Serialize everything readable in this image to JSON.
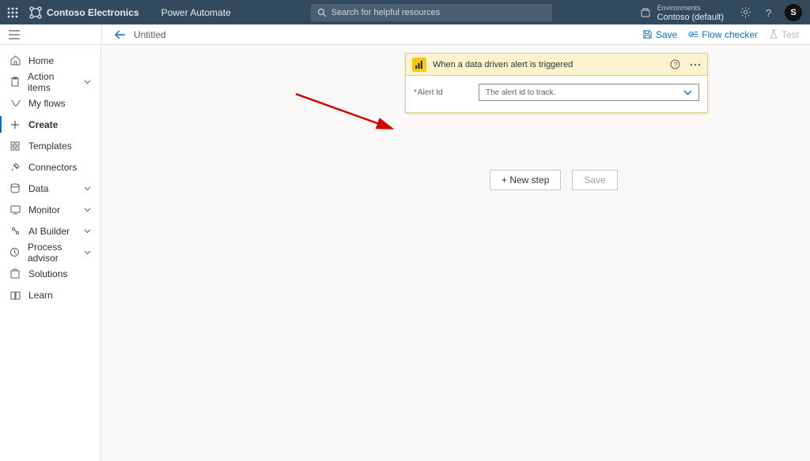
{
  "header": {
    "brand": "Contoso Electronics",
    "app": "Power Automate",
    "search_placeholder": "Search for helpful resources",
    "environment_label": "Environments",
    "environment_value": "Contoso (default)",
    "avatar_initial": "S"
  },
  "secondbar": {
    "flow_title": "Untitled",
    "save": "Save",
    "flow_checker": "Flow checker",
    "test": "Test"
  },
  "sidebar": {
    "items": [
      {
        "label": "Home",
        "icon": "home",
        "expandable": false
      },
      {
        "label": "Action items",
        "icon": "clipboard",
        "expandable": true
      },
      {
        "label": "My flows",
        "icon": "flows",
        "expandable": false
      },
      {
        "label": "Create",
        "icon": "plus",
        "expandable": false,
        "selected": true
      },
      {
        "label": "Templates",
        "icon": "grid",
        "expandable": false
      },
      {
        "label": "Connectors",
        "icon": "plug",
        "expandable": false
      },
      {
        "label": "Data",
        "icon": "data",
        "expandable": true
      },
      {
        "label": "Monitor",
        "icon": "monitor",
        "expandable": true
      },
      {
        "label": "AI Builder",
        "icon": "ai",
        "expandable": true
      },
      {
        "label": "Process advisor",
        "icon": "process",
        "expandable": true
      },
      {
        "label": "Solutions",
        "icon": "solutions",
        "expandable": false
      },
      {
        "label": "Learn",
        "icon": "learn",
        "expandable": false
      }
    ]
  },
  "card": {
    "title": "When a data driven alert is triggered",
    "param_label": "Alert Id",
    "param_placeholder": "The alert id to track."
  },
  "actions": {
    "new_step": "+ New step",
    "save_step": "Save"
  }
}
